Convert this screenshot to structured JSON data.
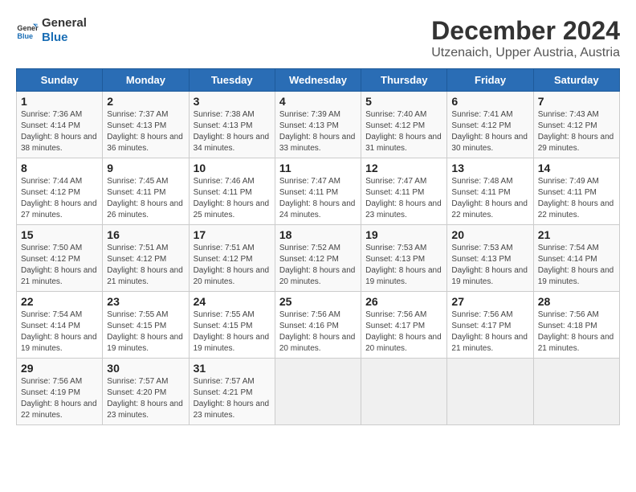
{
  "logo": {
    "line1": "General",
    "line2": "Blue"
  },
  "title": "December 2024",
  "subtitle": "Utzenaich, Upper Austria, Austria",
  "weekdays": [
    "Sunday",
    "Monday",
    "Tuesday",
    "Wednesday",
    "Thursday",
    "Friday",
    "Saturday"
  ],
  "weeks": [
    [
      {
        "day": "1",
        "sunrise": "Sunrise: 7:36 AM",
        "sunset": "Sunset: 4:14 PM",
        "daylight": "Daylight: 8 hours and 38 minutes."
      },
      {
        "day": "2",
        "sunrise": "Sunrise: 7:37 AM",
        "sunset": "Sunset: 4:13 PM",
        "daylight": "Daylight: 8 hours and 36 minutes."
      },
      {
        "day": "3",
        "sunrise": "Sunrise: 7:38 AM",
        "sunset": "Sunset: 4:13 PM",
        "daylight": "Daylight: 8 hours and 34 minutes."
      },
      {
        "day": "4",
        "sunrise": "Sunrise: 7:39 AM",
        "sunset": "Sunset: 4:13 PM",
        "daylight": "Daylight: 8 hours and 33 minutes."
      },
      {
        "day": "5",
        "sunrise": "Sunrise: 7:40 AM",
        "sunset": "Sunset: 4:12 PM",
        "daylight": "Daylight: 8 hours and 31 minutes."
      },
      {
        "day": "6",
        "sunrise": "Sunrise: 7:41 AM",
        "sunset": "Sunset: 4:12 PM",
        "daylight": "Daylight: 8 hours and 30 minutes."
      },
      {
        "day": "7",
        "sunrise": "Sunrise: 7:43 AM",
        "sunset": "Sunset: 4:12 PM",
        "daylight": "Daylight: 8 hours and 29 minutes."
      }
    ],
    [
      {
        "day": "8",
        "sunrise": "Sunrise: 7:44 AM",
        "sunset": "Sunset: 4:12 PM",
        "daylight": "Daylight: 8 hours and 27 minutes."
      },
      {
        "day": "9",
        "sunrise": "Sunrise: 7:45 AM",
        "sunset": "Sunset: 4:11 PM",
        "daylight": "Daylight: 8 hours and 26 minutes."
      },
      {
        "day": "10",
        "sunrise": "Sunrise: 7:46 AM",
        "sunset": "Sunset: 4:11 PM",
        "daylight": "Daylight: 8 hours and 25 minutes."
      },
      {
        "day": "11",
        "sunrise": "Sunrise: 7:47 AM",
        "sunset": "Sunset: 4:11 PM",
        "daylight": "Daylight: 8 hours and 24 minutes."
      },
      {
        "day": "12",
        "sunrise": "Sunrise: 7:47 AM",
        "sunset": "Sunset: 4:11 PM",
        "daylight": "Daylight: 8 hours and 23 minutes."
      },
      {
        "day": "13",
        "sunrise": "Sunrise: 7:48 AM",
        "sunset": "Sunset: 4:11 PM",
        "daylight": "Daylight: 8 hours and 22 minutes."
      },
      {
        "day": "14",
        "sunrise": "Sunrise: 7:49 AM",
        "sunset": "Sunset: 4:11 PM",
        "daylight": "Daylight: 8 hours and 22 minutes."
      }
    ],
    [
      {
        "day": "15",
        "sunrise": "Sunrise: 7:50 AM",
        "sunset": "Sunset: 4:12 PM",
        "daylight": "Daylight: 8 hours and 21 minutes."
      },
      {
        "day": "16",
        "sunrise": "Sunrise: 7:51 AM",
        "sunset": "Sunset: 4:12 PM",
        "daylight": "Daylight: 8 hours and 21 minutes."
      },
      {
        "day": "17",
        "sunrise": "Sunrise: 7:51 AM",
        "sunset": "Sunset: 4:12 PM",
        "daylight": "Daylight: 8 hours and 20 minutes."
      },
      {
        "day": "18",
        "sunrise": "Sunrise: 7:52 AM",
        "sunset": "Sunset: 4:12 PM",
        "daylight": "Daylight: 8 hours and 20 minutes."
      },
      {
        "day": "19",
        "sunrise": "Sunrise: 7:53 AM",
        "sunset": "Sunset: 4:13 PM",
        "daylight": "Daylight: 8 hours and 19 minutes."
      },
      {
        "day": "20",
        "sunrise": "Sunrise: 7:53 AM",
        "sunset": "Sunset: 4:13 PM",
        "daylight": "Daylight: 8 hours and 19 minutes."
      },
      {
        "day": "21",
        "sunrise": "Sunrise: 7:54 AM",
        "sunset": "Sunset: 4:14 PM",
        "daylight": "Daylight: 8 hours and 19 minutes."
      }
    ],
    [
      {
        "day": "22",
        "sunrise": "Sunrise: 7:54 AM",
        "sunset": "Sunset: 4:14 PM",
        "daylight": "Daylight: 8 hours and 19 minutes."
      },
      {
        "day": "23",
        "sunrise": "Sunrise: 7:55 AM",
        "sunset": "Sunset: 4:15 PM",
        "daylight": "Daylight: 8 hours and 19 minutes."
      },
      {
        "day": "24",
        "sunrise": "Sunrise: 7:55 AM",
        "sunset": "Sunset: 4:15 PM",
        "daylight": "Daylight: 8 hours and 19 minutes."
      },
      {
        "day": "25",
        "sunrise": "Sunrise: 7:56 AM",
        "sunset": "Sunset: 4:16 PM",
        "daylight": "Daylight: 8 hours and 20 minutes."
      },
      {
        "day": "26",
        "sunrise": "Sunrise: 7:56 AM",
        "sunset": "Sunset: 4:17 PM",
        "daylight": "Daylight: 8 hours and 20 minutes."
      },
      {
        "day": "27",
        "sunrise": "Sunrise: 7:56 AM",
        "sunset": "Sunset: 4:17 PM",
        "daylight": "Daylight: 8 hours and 21 minutes."
      },
      {
        "day": "28",
        "sunrise": "Sunrise: 7:56 AM",
        "sunset": "Sunset: 4:18 PM",
        "daylight": "Daylight: 8 hours and 21 minutes."
      }
    ],
    [
      {
        "day": "29",
        "sunrise": "Sunrise: 7:56 AM",
        "sunset": "Sunset: 4:19 PM",
        "daylight": "Daylight: 8 hours and 22 minutes."
      },
      {
        "day": "30",
        "sunrise": "Sunrise: 7:57 AM",
        "sunset": "Sunset: 4:20 PM",
        "daylight": "Daylight: 8 hours and 23 minutes."
      },
      {
        "day": "31",
        "sunrise": "Sunrise: 7:57 AM",
        "sunset": "Sunset: 4:21 PM",
        "daylight": "Daylight: 8 hours and 23 minutes."
      },
      null,
      null,
      null,
      null
    ]
  ]
}
